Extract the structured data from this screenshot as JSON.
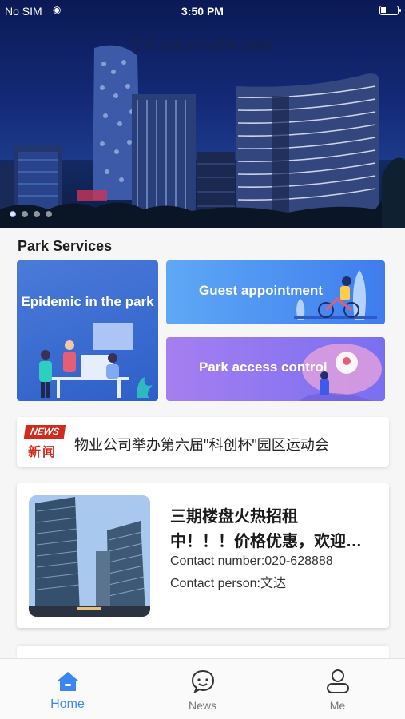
{
  "status_bar": {
    "carrier": "No SIM",
    "time": "3:50 PM"
  },
  "banner": {
    "park_status": "Did not join the park",
    "slide_count": 4,
    "active_slide": 1
  },
  "services": {
    "section_title": "Park Services",
    "items": [
      {
        "label": "Epidemic in the park"
      },
      {
        "label": "Guest appointment"
      },
      {
        "label": "Park access control"
      }
    ]
  },
  "news": {
    "badge_en": "NEWS",
    "badge_cn": "新闻",
    "headline": "物业公司举办第六届\"科创杯\"园区运动会"
  },
  "listing": {
    "title_line1": "三期楼盘火热招租",
    "title_line2": "中！！！价格优惠，欢迎咨询",
    "contact_number": "Contact number:020-628888",
    "contact_person": "Contact person:文达"
  },
  "tabbar": {
    "tabs": [
      {
        "label": "Home",
        "icon": "home-icon",
        "active": true
      },
      {
        "label": "News",
        "icon": "chat-bubble-icon",
        "active": false
      },
      {
        "label": "Me",
        "icon": "person-icon",
        "active": false
      }
    ]
  },
  "colors": {
    "accent": "#3d86f2",
    "news_red": "#d32a1e"
  }
}
